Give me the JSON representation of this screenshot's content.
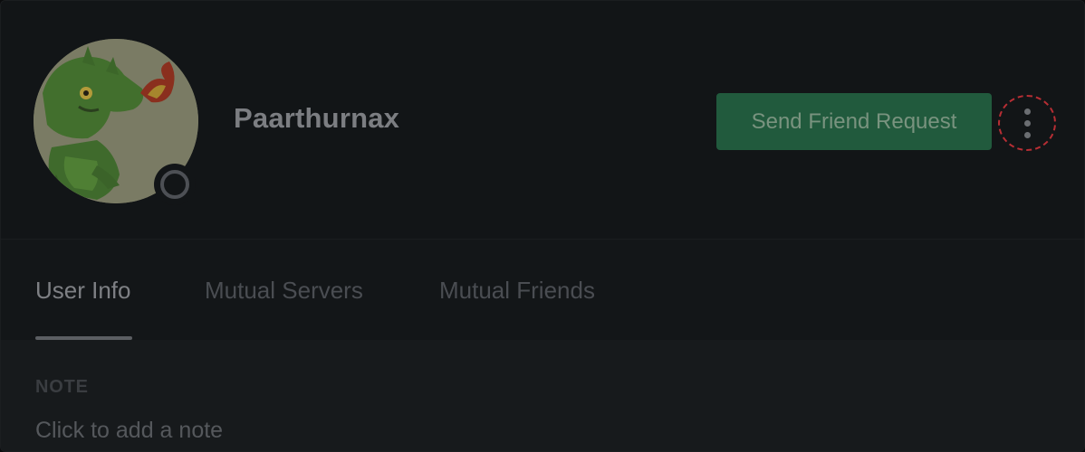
{
  "profile": {
    "username": "Paarthurnax",
    "status": "offline",
    "avatar_icon": "dragon-avatar-icon"
  },
  "header": {
    "friend_button_label": "Send Friend Request",
    "more_icon": "more-vertical-icon"
  },
  "tabs": [
    {
      "label": "User Info",
      "active": true
    },
    {
      "label": "Mutual Servers",
      "active": false
    },
    {
      "label": "Mutual Friends",
      "active": false
    }
  ],
  "note": {
    "label": "NOTE",
    "placeholder": "Click to add a note"
  },
  "colors": {
    "button_green": "#215a3d",
    "highlight_red": "#b72e34",
    "background": "#131618"
  }
}
